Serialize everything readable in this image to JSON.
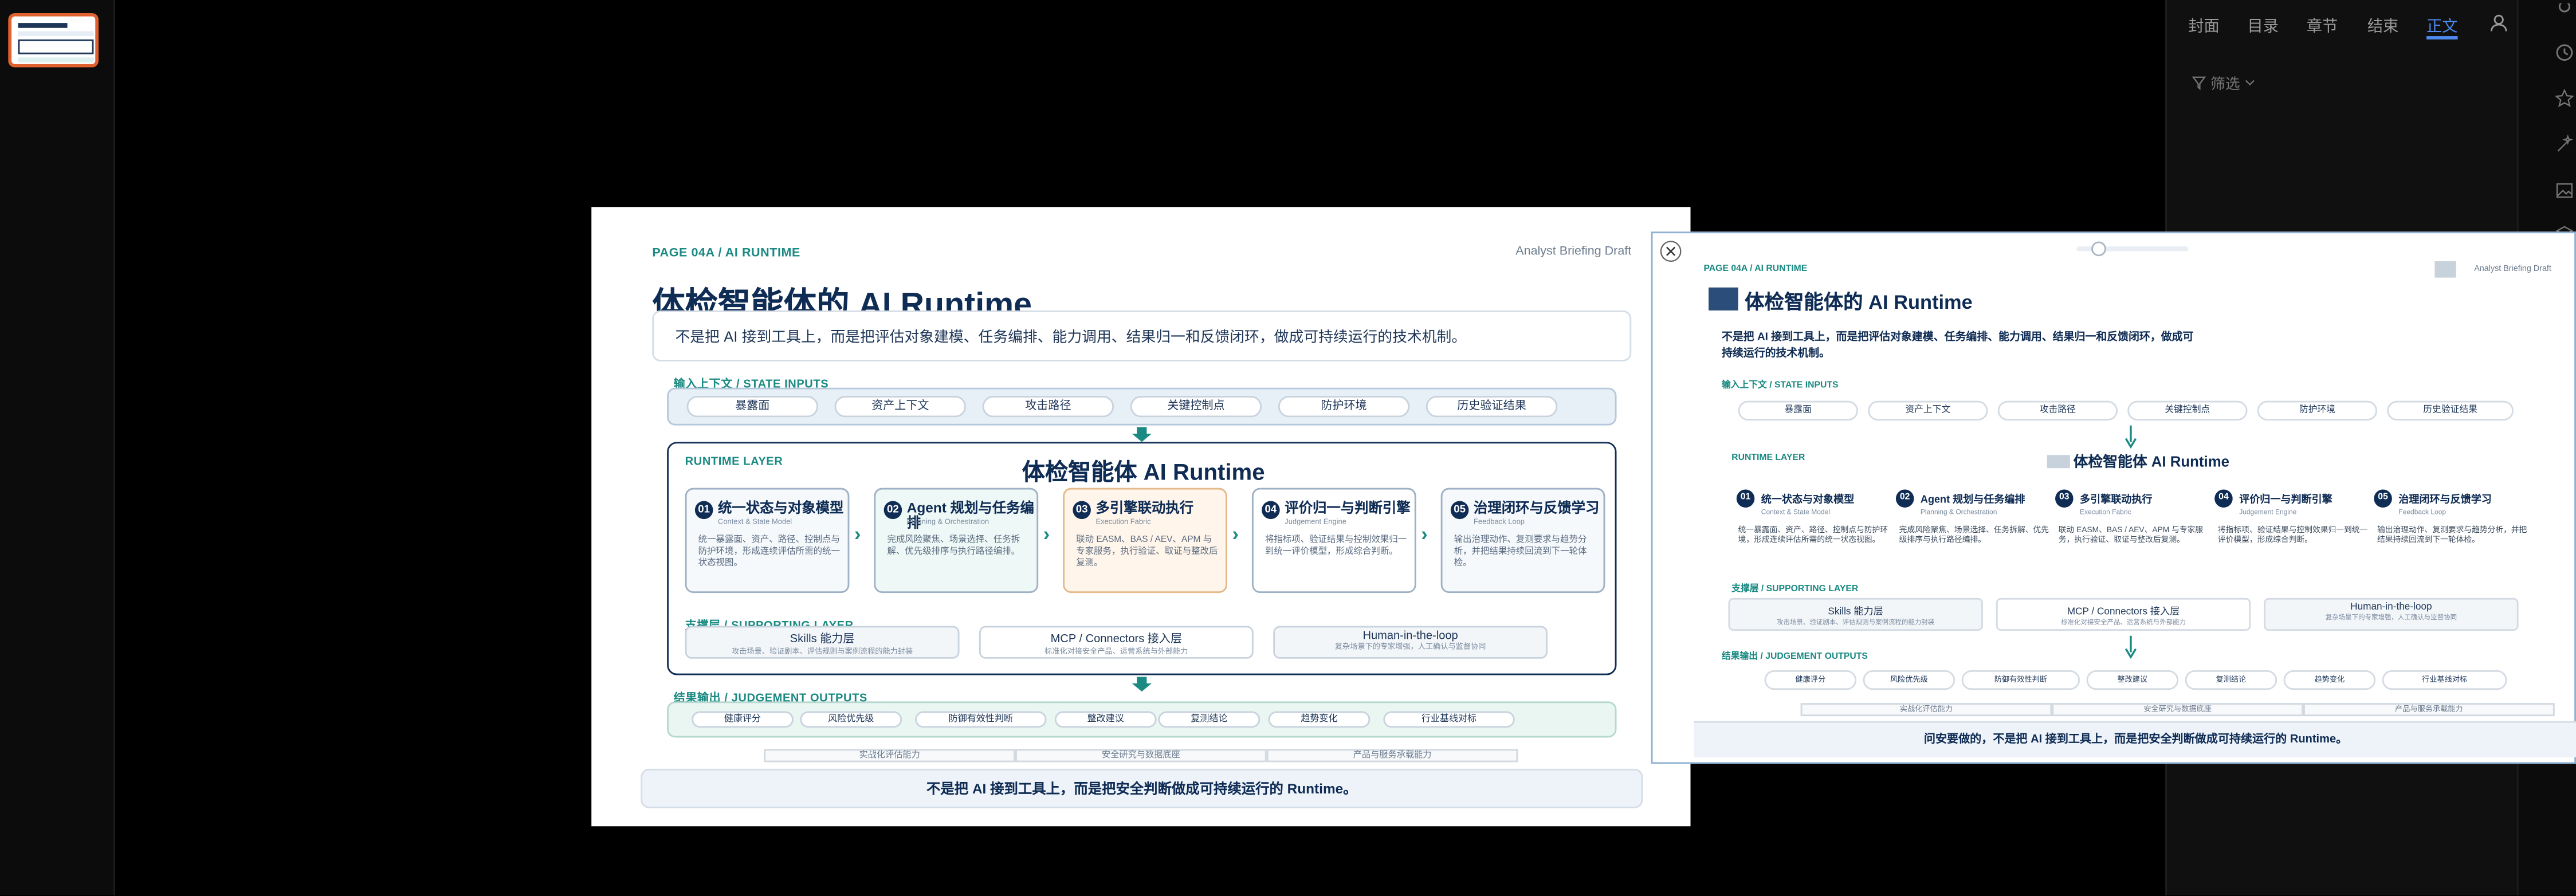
{
  "nav": {
    "tabs": [
      "封面",
      "目录",
      "章节",
      "结束",
      "正文"
    ],
    "active_tab": "正文",
    "filter_label": "筛选"
  },
  "slide": {
    "eyebrow": "PAGE 04A / AI RUNTIME",
    "corner": "Analyst Briefing Draft",
    "title": "体检智能体的 AI Runtime",
    "subtitle": "不是把 AI 接到工具上，而是把评估对象建模、任务编排、能力调用、结果归一和反馈闭环，做成可持续运行的技术机制。",
    "inputs_label": "输入上下文 / STATE INPUTS",
    "inputs": [
      "暴露面",
      "资产上下文",
      "攻击路径",
      "关键控制点",
      "防护环境",
      "历史验证结果"
    ],
    "runtime_label": "RUNTIME LAYER",
    "runtime_title": "体检智能体 AI Runtime",
    "stages": [
      {
        "num": "01",
        "title": "统一状态与对象模型",
        "sub": "Context & State Model",
        "body": "统一暴露面、资产、路径、控制点与防护环境，形成连续评估所需的统一状态视图。"
      },
      {
        "num": "02",
        "title": "Agent 规划与任务编排",
        "sub": "Planning & Orchestration",
        "body": "完成风险聚焦、场景选择、任务拆解、优先级排序与执行路径编排。"
      },
      {
        "num": "03",
        "title": "多引擎联动执行",
        "sub": "Execution Fabric",
        "body": "联动 EASM、BAS / AEV、APM 与专家服务，执行验证、取证与整改后复测。"
      },
      {
        "num": "04",
        "title": "评价归一与判断引擎",
        "sub": "Judgement Engine",
        "body": "将指标项、验证结果与控制效果归一到统一评价模型，形成综合判断。"
      },
      {
        "num": "05",
        "title": "治理闭环与反馈学习",
        "sub": "Feedback Loop",
        "body": "输出治理动作、复测要求与趋势分析，并把结果持续回流到下一轮体检。"
      }
    ],
    "support_label": "支撑层 / SUPPORTING LAYER",
    "support": [
      {
        "title": "Skills 能力层",
        "sub": "攻击场景、验证剧本、评估规则与案例流程的能力封装"
      },
      {
        "title": "MCP / Connectors 接入层",
        "sub": "标准化对接安全产品、运营系统与外部能力"
      },
      {
        "title": "Human-in-the-loop",
        "sub": "复杂场景下的专家增强，人工确认与监督协同"
      }
    ],
    "outputs_label": "结果输出 / JUDGEMENT OUTPUTS",
    "outputs": [
      "健康评分",
      "风险优先级",
      "防御有效性判断",
      "整改建议",
      "复测结论",
      "趋势变化",
      "行业基线对标"
    ],
    "bottom_bars": [
      "实战化评估能力",
      "安全研究与数据底座",
      "产品与服务承载能力"
    ],
    "footer": "不是把 AI 接到工具上，而是把安全判断做成可持续运行的 Runtime。"
  },
  "preview": {
    "footer": "问安要做的，不是把 AI 接到工具上，而是把安全判断做成可持续运行的 Runtime。",
    "zoom_percent": 20
  },
  "colors": {
    "accent": "#1a8a83",
    "navy": "#0f2c54",
    "tab_active": "#4d8af0",
    "thumb_border": "#e0612d"
  }
}
